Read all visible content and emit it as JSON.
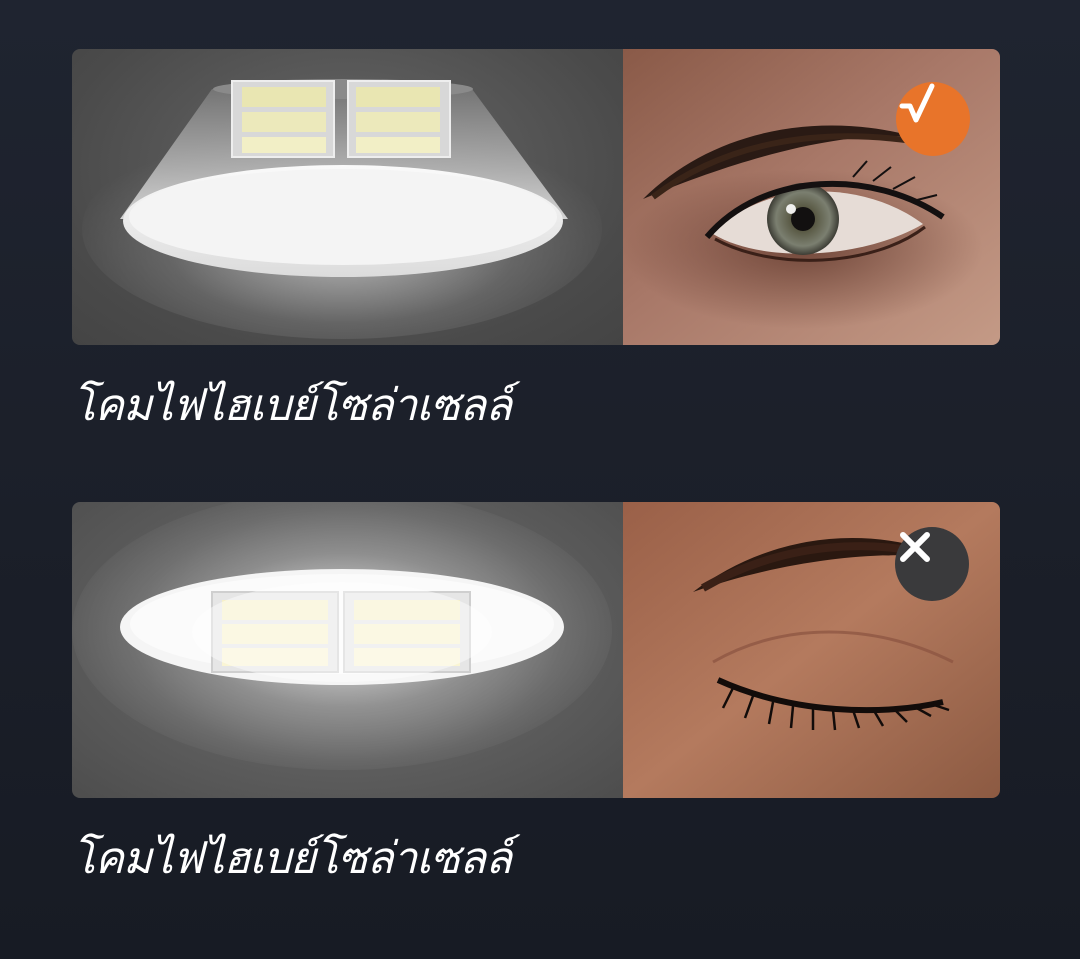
{
  "comparisons": [
    {
      "caption": "โคมไฟไฮเบย์โซล่าเซลล์",
      "result": "good",
      "badge_icon": "checkmark-icon",
      "badge_color": "#e8742a"
    },
    {
      "caption": "โคมไฟไฮเบย์โซล่าเซลล์",
      "result": "bad",
      "badge_icon": "x-mark-icon",
      "badge_color": "#3a3a3c"
    }
  ]
}
